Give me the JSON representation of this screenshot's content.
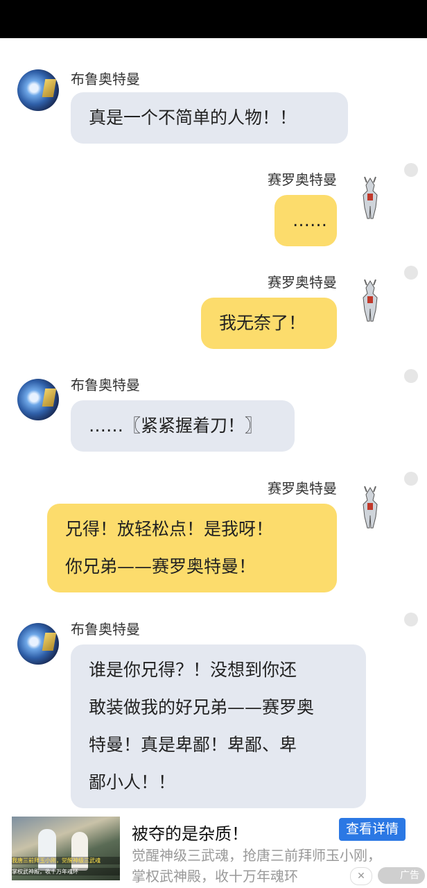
{
  "chat": {
    "messages": [
      {
        "sender": "布鲁奥特曼",
        "lines": [
          "真是一个不简单的人物！！"
        ]
      },
      {
        "sender": "赛罗奥特曼",
        "lines": [
          "……"
        ]
      },
      {
        "sender": "赛罗奥特曼",
        "lines": [
          "我无奈了！"
        ]
      },
      {
        "sender": "布鲁奥特曼",
        "lines": [
          "……〖紧紧握着刀！〗"
        ]
      },
      {
        "sender": "赛罗奥特曼",
        "lines": [
          "兄得！放轻松点！是我呀！",
          "你兄弟——赛罗奥特曼！"
        ]
      },
      {
        "sender": "布鲁奥特曼",
        "lines": [
          "谁是你兄得？！没想到你还",
          "敢装做我的好兄弟——赛罗奥",
          "特曼！真是卑鄙！卑鄙、卑",
          "鄙小人！！"
        ]
      }
    ]
  },
  "ad": {
    "title": "被夺的是杂质！",
    "button_label": "查看详情",
    "desc_line1": "觉醒神级三武魂，抢唐三前拜师玉小刚，",
    "desc_line2": "掌权武神殿，收十万年魂环",
    "ad_tag": "广告",
    "close_glyph": "✕",
    "thumb_caption1": "我唐三前拜玉小刚，觉醒神级三武魂",
    "thumb_caption2": "掌权武神殿，收十万年魂环"
  },
  "colors": {
    "grey_bubble": "#e4e8f0",
    "yellow_bubble": "#fcdc6c",
    "ad_button": "#2b78e4"
  }
}
